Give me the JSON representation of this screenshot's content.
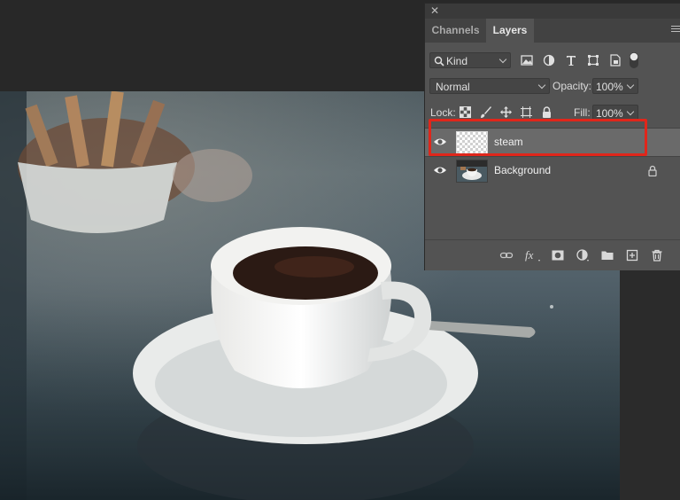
{
  "panel": {
    "tabs": [
      {
        "label": "Channels",
        "active": false
      },
      {
        "label": "Layers",
        "active": true
      }
    ],
    "filter": {
      "kind_label": "Kind",
      "icons": [
        "image-filter-icon",
        "adjustment-filter-icon",
        "type-filter-icon",
        "shape-filter-icon",
        "smart-object-filter-icon",
        "filter-toggle-icon"
      ]
    },
    "blend_mode": "Normal",
    "opacity_label": "Opacity:",
    "opacity_value": "100%",
    "lock_label": "Lock:",
    "lock_icons": [
      "lock-transparent-pixels-icon",
      "lock-image-pixels-icon",
      "lock-position-icon",
      "lock-artboard-icon",
      "lock-all-icon"
    ],
    "fill_label": "Fill:",
    "fill_value": "100%",
    "layers": [
      {
        "name": "steam",
        "visible": true,
        "selected": true,
        "locked": false
      },
      {
        "name": "Background",
        "visible": true,
        "selected": false,
        "locked": true
      }
    ],
    "footer_icons": [
      "link-layers-icon",
      "layer-style-fx-icon",
      "add-mask-icon",
      "adjustment-layer-icon",
      "new-group-folder-icon",
      "new-layer-icon",
      "delete-trash-icon"
    ]
  },
  "colors": {
    "highlight": "#e0261b",
    "panel_bg": "#535353",
    "selected_row": "#6a6a6a"
  }
}
